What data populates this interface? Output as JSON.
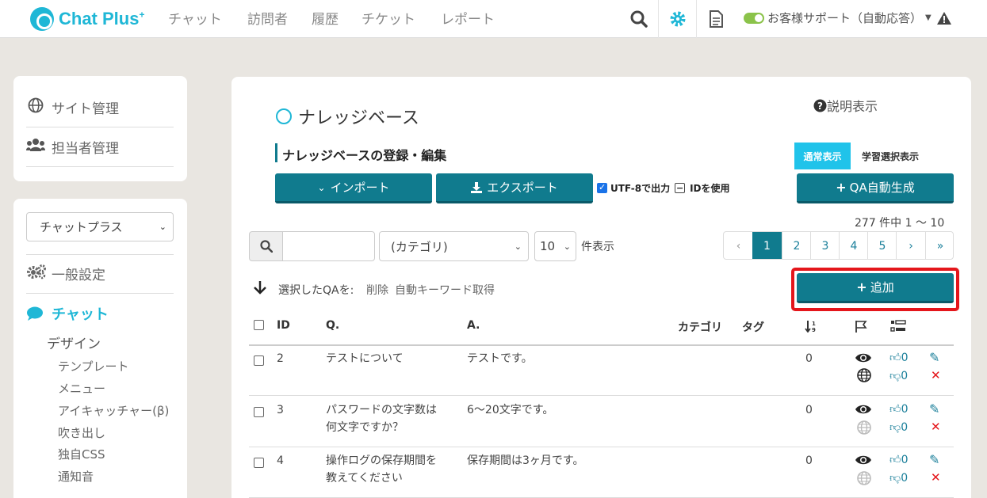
{
  "colors": {
    "accent": "#1fb7d6",
    "button": "#107b8e",
    "highlight": "#e4161b",
    "toggle": "#8bc34a"
  },
  "header": {
    "logo": "Chat Plus",
    "logo_plus": "+",
    "nav": [
      "チャット",
      "訪問者",
      "履歴",
      "チケット",
      "レポート"
    ],
    "icons": [
      "search-icon",
      "gear-icon",
      "document-icon"
    ],
    "status_label": "お客様サポート（自動応答）"
  },
  "sidebar": {
    "top_links": [
      {
        "icon": "globe-icon",
        "label": "サイト管理"
      },
      {
        "icon": "users-icon",
        "label": "担当者管理"
      }
    ],
    "site_select": "チャットプラス",
    "general_settings": "一般設定",
    "chat": "チャット",
    "design": "デザイン",
    "design_items": [
      "テンプレート",
      "メニュー",
      "アイキャッチャー(β)",
      "吹き出し",
      "独自CSS",
      "通知音"
    ]
  },
  "main": {
    "help_label": "説明表示",
    "title": "ナレッジベース",
    "section_title": "ナレッジベースの登録・編集",
    "view_normal": "通常表示",
    "view_learning": "学習選択表示",
    "import_label": "インポート",
    "export_label": "エクスポート",
    "utf8_label": "UTF-8で出力",
    "id_label": "IDを使用",
    "qa_auto_label": "QA自動生成",
    "count_text": "277 件中 1 ～ 10",
    "search_placeholder": "",
    "category_select": "(カテゴリ)",
    "per_page_select": "10",
    "per_page_label": "件表示",
    "pagination": [
      "‹",
      "1",
      "2",
      "3",
      "4",
      "5",
      "›",
      "»"
    ],
    "bulk_label": "選択したQAを:",
    "bulk_delete": "削除",
    "bulk_keyword": "自動キーワード取得",
    "add_label": "追加"
  },
  "table": {
    "headers": {
      "id": "ID",
      "q": "Q.",
      "a": "A.",
      "category": "カテゴリ",
      "tag": "タグ"
    },
    "rows": [
      {
        "id": "2",
        "q1": "テストについて",
        "q2": "",
        "a": "テストです。",
        "sort": "0",
        "like": "0",
        "dislike": "0",
        "published": true
      },
      {
        "id": "3",
        "q1": "パスワードの文字数は",
        "q2": "何文字ですか？",
        "a": "6～20文字です。",
        "sort": "0",
        "like": "0",
        "dislike": "0",
        "published": false
      },
      {
        "id": "4",
        "q1": "操作ログの保存期間を",
        "q2": "教えてください",
        "a": "保存期間は3ヶ月です。",
        "sort": "0",
        "like": "0",
        "dislike": "0",
        "published": false
      }
    ]
  }
}
